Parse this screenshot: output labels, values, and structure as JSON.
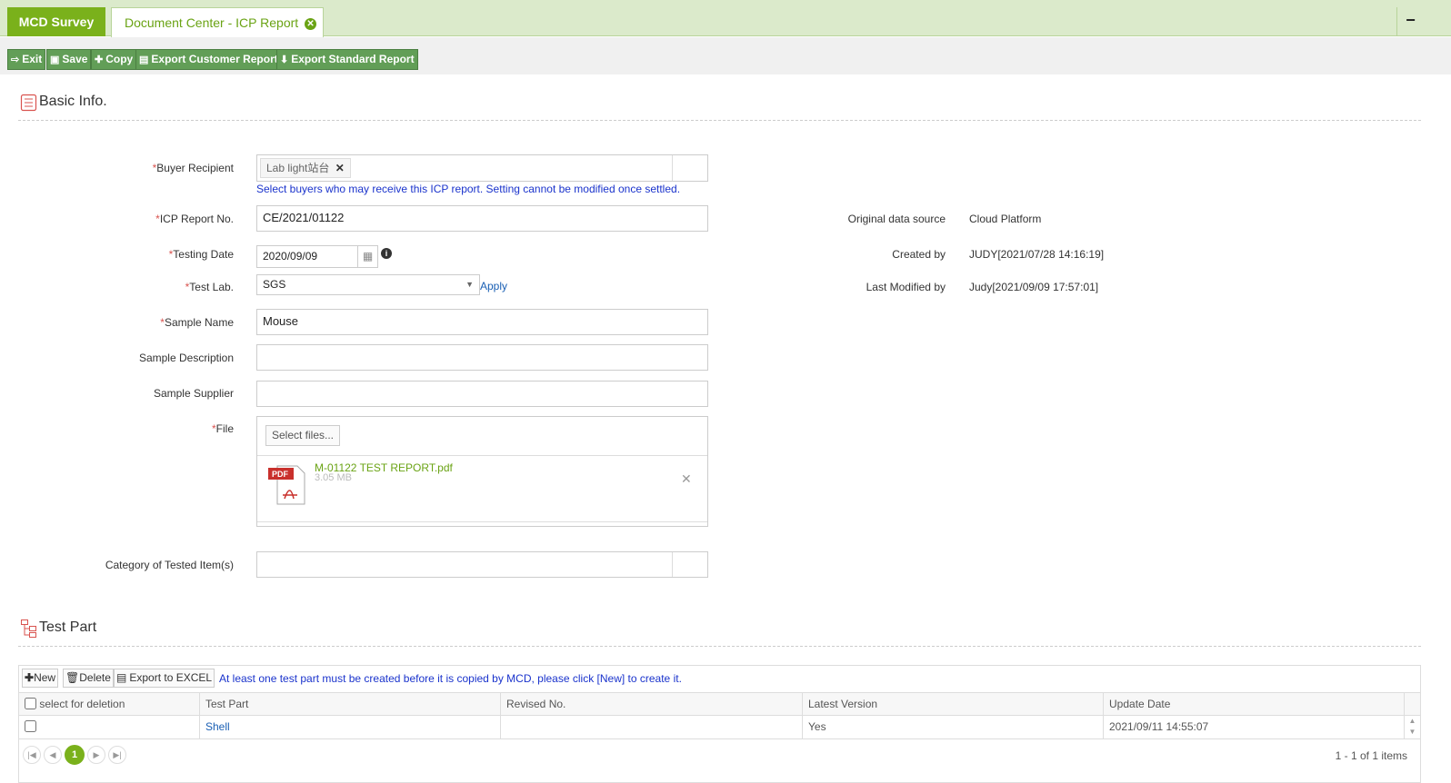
{
  "tabs": {
    "main": "MCD Survey",
    "active": "Document Center - ICP Report"
  },
  "toolbar": {
    "exit": "Exit",
    "save": "Save",
    "copy": "Copy",
    "export_customer": "Export Customer Report",
    "export_standard": "Export Standard Report"
  },
  "basic": {
    "title": "Basic Info.",
    "buyer_label": "Buyer Recipient",
    "buyer_tag": "Lab light站台",
    "buyer_hint": "Select buyers who may receive this ICP report. Setting cannot be modified once settled.",
    "icp_label": "ICP Report No.",
    "icp_value": "CE/2021/01122",
    "testing_date_label": "Testing Date",
    "testing_date_value": "2020/09/09",
    "test_lab_label": "Test Lab.",
    "test_lab_value": "SGS",
    "apply": "Apply",
    "sample_name_label": "Sample Name",
    "sample_name_value": "Mouse",
    "sample_desc_label": "Sample Description",
    "sample_supplier_label": "Sample Supplier",
    "file_label": "File",
    "select_files": "Select files...",
    "file_name": "M-01122 TEST REPORT.pdf",
    "file_size": "3.05 MB",
    "category_label": "Category of Tested Item(s)"
  },
  "meta": {
    "source_label": "Original data source",
    "source_value": "Cloud Platform",
    "created_label": "Created by",
    "created_value": "JUDY[2021/07/28 14:16:19]",
    "modified_label": "Last Modified by",
    "modified_value": "Judy[2021/09/09 17:57:01]"
  },
  "testpart": {
    "title": "Test Part",
    "new": "New",
    "delete": "Delete",
    "export": "Export to EXCEL",
    "notice": "At least one test part must be created before it is copied by MCD, please click [New] to create it.",
    "columns": [
      "select for deletion",
      "Test Part",
      "Revised No.",
      "Latest Version",
      "Update Date"
    ],
    "rows": [
      {
        "part": "Shell",
        "revised": "",
        "latest": "Yes",
        "date": "2021/09/11 14:55:07"
      }
    ],
    "page": "1",
    "summary": "1 - 1 of 1 items"
  },
  "colors": {
    "brand_green": "#7ab11b",
    "button_green": "#629e57",
    "hint_blue": "#1a33cc"
  }
}
